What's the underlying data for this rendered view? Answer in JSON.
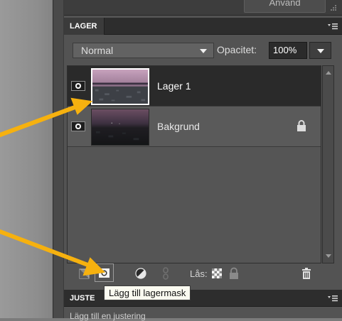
{
  "top_strip": {
    "button_label": "Anvand"
  },
  "layers_panel": {
    "title": "LAGER",
    "blend_mode": "Normal",
    "opacity_label": "Opacitet:",
    "opacity_value": "100%",
    "layers": [
      {
        "name": "Lager 1",
        "selected": true,
        "visible": true,
        "locked": false
      },
      {
        "name": "Bakgrund",
        "selected": false,
        "visible": true,
        "locked": true
      }
    ],
    "toolbar": {
      "lock_label": "Lås:",
      "icons": [
        "new-layer-icon",
        "add-mask-icon",
        "adjustment-icon",
        "link-icon",
        "lock-transparency-icon",
        "lock-all-icon",
        "trash-icon"
      ]
    },
    "tooltip": "Lägg till lagermask"
  },
  "adjustments_panel": {
    "title": "JUSTE",
    "partial_text": "Lägg till en justering"
  },
  "colors": {
    "panel_bg": "#535353",
    "selected_row": "#2a2a2a",
    "annotation_arrow": "#f6b10f"
  }
}
